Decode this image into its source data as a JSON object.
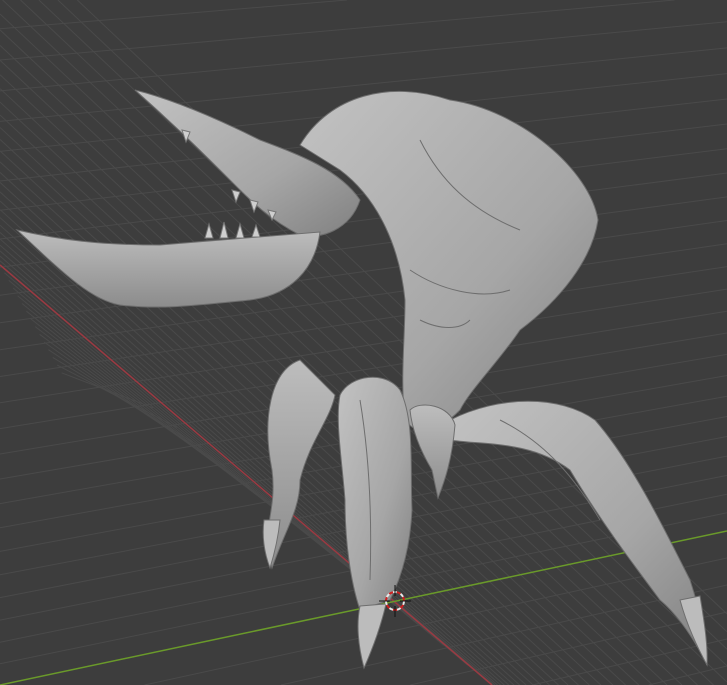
{
  "viewport": {
    "background_color": "#3d3d3d",
    "grid_color": "#4a4a4a",
    "x_axis_color": "#9b3a42",
    "y_axis_color": "#6a9a2a",
    "model_color": "#a9a9a9",
    "cursor_icon": "3d-cursor-icon"
  }
}
